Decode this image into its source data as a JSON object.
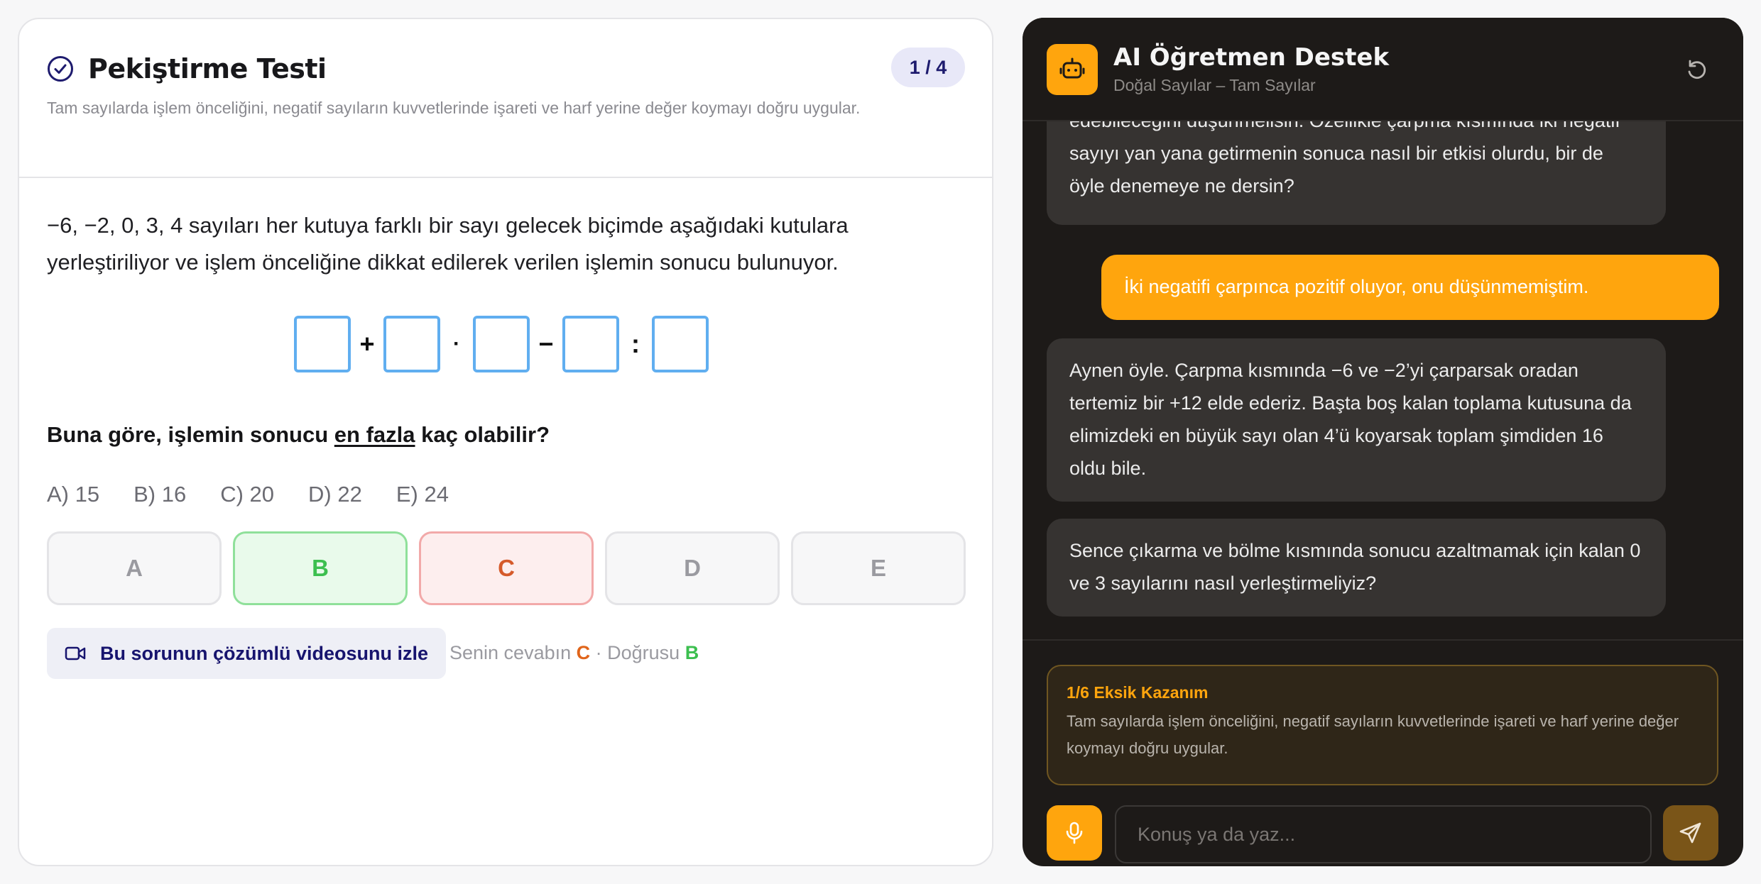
{
  "quiz": {
    "title": "Pekiştirme Testi",
    "counter": "1 / 4",
    "description": "Tam sayılarda işlem önceliğini, negatif sayıların kuvvetlerinde işareti ve harf yerine değer koymayı doğru uygular.",
    "question": "−6, −2, 0, 3, 4 sayıları her kutuya farklı bir sayı gelecek biçimde aşağıdaki kutulara yerleştiriliyor ve işlem önceliğine dikkat edilerek verilen işlemin sonucu bulunuyor.",
    "operators": [
      "+",
      "·",
      "−",
      ":"
    ],
    "prompt_before": "Buna göre, işlemin sonucu ",
    "prompt_underline": "en fazla",
    "prompt_after": " kaç olabilir?",
    "options": [
      "A) 15",
      "B) 16",
      "C) 20",
      "D) 22",
      "E) 24"
    ],
    "choices": [
      "A",
      "B",
      "C",
      "D",
      "E"
    ],
    "video_label": "Bu sorunun çözümlü videosunu izle",
    "status_prefix": "Senin cevabın ",
    "your_answer": "C",
    "status_middle": " · Doğrusu ",
    "correct_answer": "B"
  },
  "chat": {
    "title": "AI Öğretmen Destek",
    "subtitle": "Doğal Sayılar – Tam Sayılar",
    "messages": [
      {
        "role": "bot",
        "text": "edebileceğini düşünmelisin. Özellikle çarpma kısmında iki negatif sayıyı yan yana getirmenin sonuca nasıl bir etkisi olurdu, bir de öyle denemeye ne dersin?"
      },
      {
        "role": "user",
        "text": "İki negatifi çarpınca pozitif oluyor, onu düşünmemiştim."
      },
      {
        "role": "bot",
        "text": "Aynen öyle. Çarpma kısmında −6 ve −2’yi çarparsak oradan tertemiz bir +12 elde ederiz. Başta boş kalan toplama kutusuna da elimizdeki en büyük sayı olan 4’ü koyarsak toplam şimdiden 16 oldu bile."
      },
      {
        "role": "bot",
        "text": "Sence çıkarma ve bölme kısmında sonucu azaltmamak için kalan 0 ve 3 sayılarını nasıl yerleştirmeliyiz?"
      }
    ],
    "missing_title": "1/6 Eksik Kazanım",
    "missing_desc": "Tam sayılarda işlem önceliğini, negatif sayıların kuvvetlerinde işareti ve harf yerine değer koymayı doğru uygular.",
    "input_placeholder": "Konuş ya da yaz..."
  },
  "colors": {
    "accent_orange": "#ffa50d",
    "correct_green": "#3cbf4f",
    "wrong_orange": "#e0651b",
    "box_blue": "#60aef0"
  },
  "icons": [
    "check-circle-icon",
    "video-camera-icon",
    "robot-icon",
    "refresh-icon",
    "microphone-icon",
    "send-icon"
  ]
}
